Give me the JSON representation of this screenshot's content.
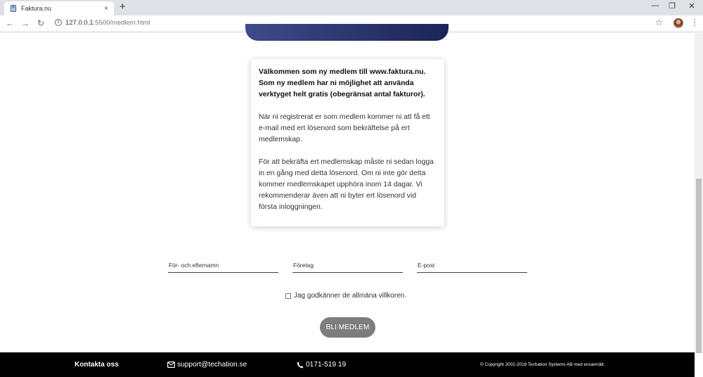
{
  "browser": {
    "tab_title": "Faktura.nu",
    "tab_close": "×",
    "new_tab": "+",
    "url_host": "127.0.0.1",
    "url_path": ":5500/medlem.html",
    "window_controls": {
      "minimize": "—",
      "restore": "❐",
      "close": "✕"
    },
    "nav": {
      "back": "←",
      "forward": "→",
      "reload": "↻"
    },
    "bookmark_star": "☆",
    "menu": "⋮"
  },
  "card": {
    "lead": "Välkommen som ny medlem till www.faktura.nu. Som ny medlem har ni möjlighet att använda verktyget helt gratis (obegränsat antal fakturor).",
    "body1": "När ni registrerat er som medlem kommer ni att få ett e-mail med ert lösenord som bekräftelse på ert medlemskap.",
    "body2": "För att bekräfta ert medlemskap måste ni sedan logga in en gång med detta lösenord. Om ni inte gör detta kommer medlemskapet upphöra inom 14 dagar. Vi rekommenderar även att ni byter ert lösenord vid första inloggningen."
  },
  "form": {
    "name_placeholder": "För- och efternamn",
    "company_placeholder": "Företag",
    "email_placeholder": "E-post",
    "terms_label": "Jag godkänner de allmäna villkoren.",
    "submit_label": "BLI MEDLEM"
  },
  "footer": {
    "contact_title": "Kontakta oss",
    "email": "support@techation.se",
    "phone": "0171-519 19",
    "copyright": "© Copyright 2002-2018 Techation Systems AB med ensamrätt."
  },
  "colors": {
    "hero_bar": "#2b3470",
    "button": "#7d7d7d",
    "footer_bg": "#000000"
  },
  "icons": [
    "calculator-icon",
    "info-icon",
    "star-icon",
    "envelope-icon",
    "phone-icon"
  ]
}
